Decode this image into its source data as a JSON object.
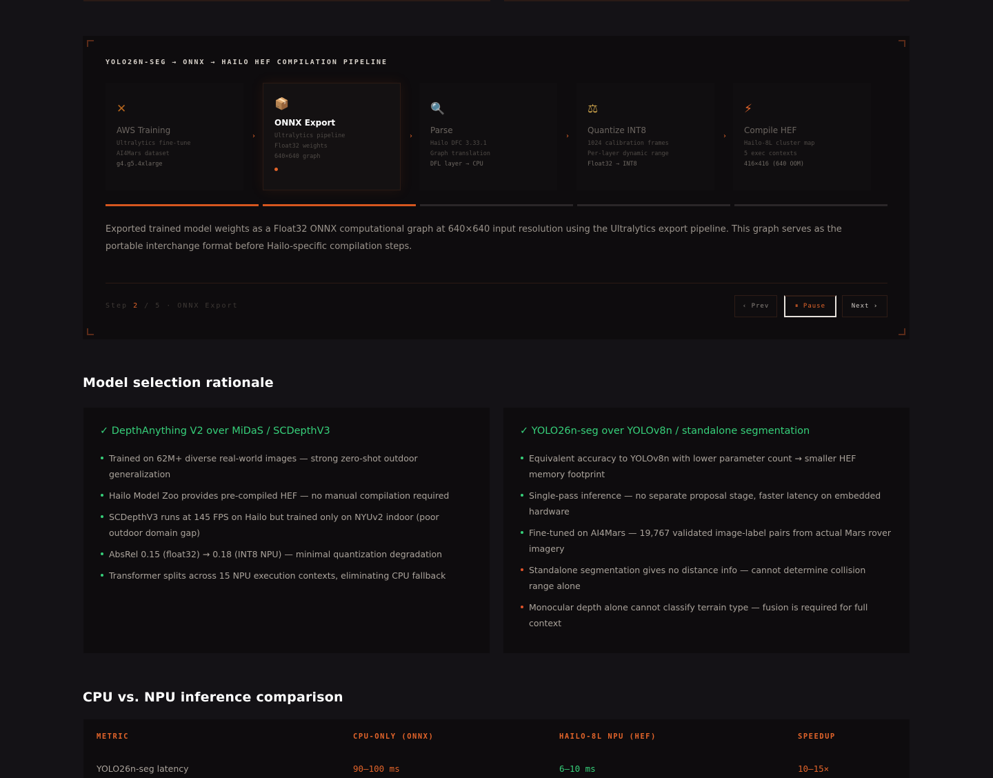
{
  "pipeline": {
    "title": "YOLO26N-SEG → ONNX → HAILO HEF COMPILATION PIPELINE",
    "steps": [
      {
        "icon": "drone-icon",
        "glyph": "✕",
        "glyph_color": "#b5651d",
        "name": "AWS Training",
        "details": [
          "Ultralytics fine-tune",
          "AI4Mars dataset",
          "g4.g5.4xlarge"
        ],
        "active": false
      },
      {
        "icon": "package-icon",
        "glyph": "📦",
        "glyph_color": "#c98a4a",
        "name": "ONNX Export",
        "details": [
          "Ultralytics pipeline",
          "Float32 weights",
          "640×640 graph"
        ],
        "active": true
      },
      {
        "icon": "magnifier-icon",
        "glyph": "🔍",
        "glyph_color": "#4a8fd4",
        "name": "Parse",
        "details": [
          "Hailo DFC 3.33.1",
          "Graph translation",
          "DFL layer → CPU"
        ],
        "active": false
      },
      {
        "icon": "scale-icon",
        "glyph": "⚖",
        "glyph_color": "#c9a04a",
        "name": "Quantize INT8",
        "details": [
          "1024 calibration frames",
          "Per-layer dynamic range",
          "Float32 → INT8"
        ],
        "active": false
      },
      {
        "icon": "lightning-icon",
        "glyph": "⚡",
        "glyph_color": "#e2642a",
        "name": "Compile HEF",
        "details": [
          "Hailo-8L cluster map",
          "5 exec contexts",
          "416×416 (640 OOM)"
        ],
        "active": false
      }
    ],
    "progress": 0.4,
    "description": "Exported trained model weights as a Float32 ONNX computational graph at 640×640 input resolution using the Ultralytics export pipeline. This graph serves as the portable interchange format before Hailo-specific compilation steps.",
    "status_prefix": "Step ",
    "status_current": "2",
    "status_suffix": " / 5 · ONNX Export",
    "prev_label": "‹ Prev",
    "pause_label": "⏸ Pause",
    "next_label": "Next ›"
  },
  "model_section": {
    "heading": "Model selection rationale",
    "left": {
      "title": "✓ DepthAnything V2 over MiDaS / SCDepthV3",
      "items": [
        {
          "text": "Trained on 62M+ diverse real-world images — strong zero-shot outdoor generalization",
          "tone": "positive"
        },
        {
          "text": "Hailo Model Zoo provides pre-compiled HEF — no manual compilation required",
          "tone": "positive"
        },
        {
          "text": "SCDepthV3 runs at 145 FPS on Hailo but trained only on NYUv2 indoor (poor outdoor domain gap)",
          "tone": "positive"
        },
        {
          "text": "AbsRel 0.15 (float32) → 0.18 (INT8 NPU) — minimal quantization degradation",
          "tone": "positive"
        },
        {
          "text": "Transformer splits across 15 NPU execution contexts, eliminating CPU fallback",
          "tone": "positive"
        }
      ]
    },
    "right": {
      "title": "✓ YOLO26n-seg over YOLOv8n / standalone segmentation",
      "items": [
        {
          "text": "Equivalent accuracy to YOLOv8n with lower parameter count → smaller HEF memory footprint",
          "tone": "positive"
        },
        {
          "text": "Single-pass inference — no separate proposal stage, faster latency on embedded hardware",
          "tone": "positive"
        },
        {
          "text": "Fine-tuned on AI4Mars — 19,767 validated image-label pairs from actual Mars rover imagery",
          "tone": "positive"
        },
        {
          "text": "Standalone segmentation gives no distance info — cannot determine collision range alone",
          "tone": "negative"
        },
        {
          "text": "Monocular depth alone cannot classify terrain type — fusion is required for full context",
          "tone": "negative"
        }
      ]
    }
  },
  "comparison": {
    "heading": "CPU vs. NPU inference comparison",
    "columns": [
      "METRIC",
      "CPU-ONLY (ONNX)",
      "HAILO-8L NPU (HEF)",
      "SPEEDUP"
    ],
    "rows": [
      {
        "metric": "YOLO26n-seg latency",
        "cpu": "90–100 ms",
        "npu": "6–10 ms",
        "speedup": "10–15×"
      }
    ],
    "colors": {
      "accent": "#e2642a",
      "positive": "#36d07a"
    }
  }
}
